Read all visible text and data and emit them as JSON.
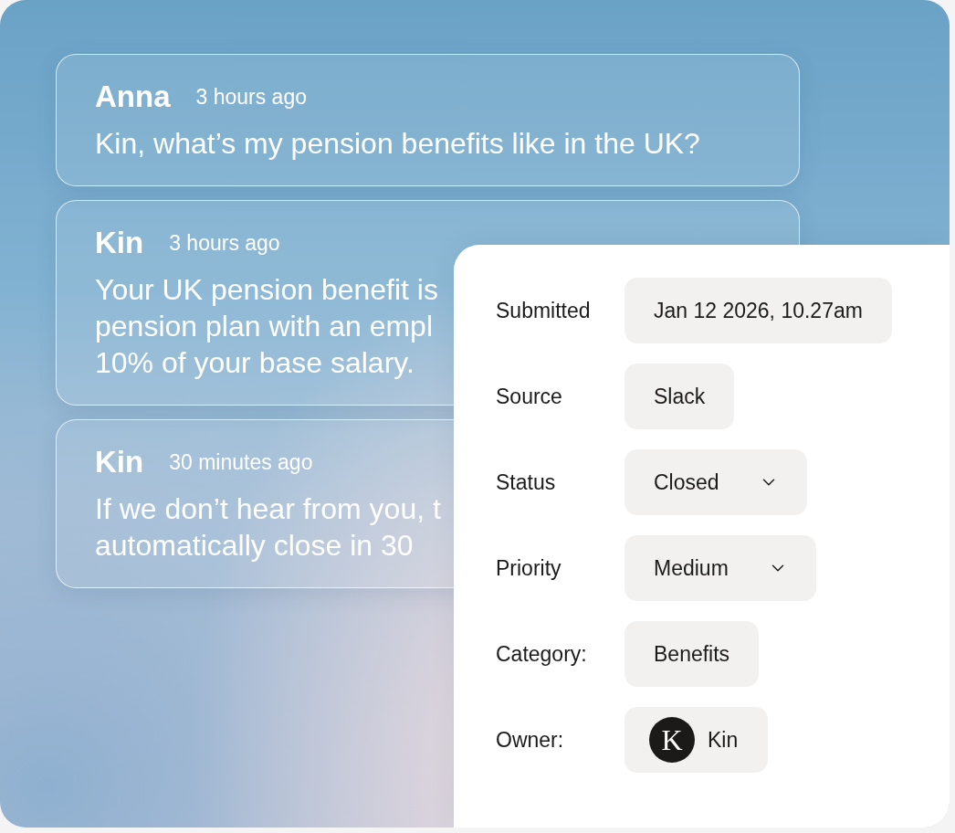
{
  "messages": [
    {
      "sender": "Anna",
      "time": "3 hours ago",
      "lines": [
        "Kin, what’s my pension benefits like in the UK?"
      ]
    },
    {
      "sender": "Kin",
      "time": "3 hours ago",
      "lines": [
        "Your UK pension benefit is",
        "pension plan with an empl",
        "10% of your base salary."
      ]
    },
    {
      "sender": "Kin",
      "time": "30 minutes ago",
      "lines": [
        "If we don’t hear from you, t",
        "automatically close in 30"
      ]
    }
  ],
  "details": {
    "fields": [
      {
        "kind": "text",
        "label": "Submitted",
        "value": "Jan 12 2026, 10.27am"
      },
      {
        "kind": "text",
        "label": "Source",
        "value": "Slack"
      },
      {
        "kind": "select",
        "label": "Status",
        "value": "Closed"
      },
      {
        "kind": "select",
        "label": "Priority",
        "value": "Medium"
      },
      {
        "kind": "text",
        "label": "Category:",
        "value": "Benefits"
      },
      {
        "kind": "user",
        "label": "Owner:",
        "value": "Kin",
        "avatar_letter": "K"
      }
    ]
  }
}
